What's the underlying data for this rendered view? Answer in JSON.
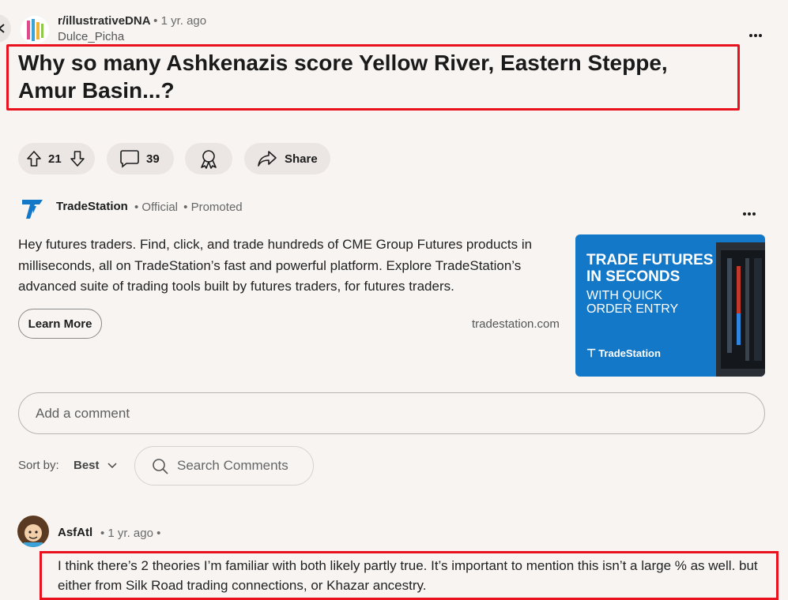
{
  "post": {
    "subreddit": "r/illustrativeDNA",
    "time": "• 1 yr. ago",
    "author": "Dulce_Picha",
    "title": "Why so many Ashkenazis score Yellow River, Eastern Steppe, Amur Basin...?",
    "upvotes": "21",
    "comments_count": "39",
    "share_label": "Share"
  },
  "ad": {
    "advertiser": "TradeStation",
    "official": "• Official",
    "promoted": "• Promoted",
    "text": "Hey futures traders. Find, click, and trade hundreds of CME Group Futures products in milliseconds, all on TradeStation’s fast and powerful platform. Explore TradeStation’s advanced suite of trading tools built by futures traders, for futures traders.",
    "cta": "Learn More",
    "domain": "tradestation.com",
    "banner_line1": "TRADE FUTURES IN SECONDS",
    "banner_line2": "WITH QUICK ORDER ENTRY",
    "banner_brand": "TradeStation"
  },
  "comments_section": {
    "add_comment_placeholder": "Add a comment",
    "sort_label": "Sort by:",
    "sort_value": "Best",
    "search_placeholder": "Search Comments"
  },
  "comment": {
    "author": "AsfAtl",
    "meta": "• 1 yr. ago •",
    "text": "I think there’s 2 theories I’m familiar with both likely partly true. It’s important to mention this isn’t a large % as well. but either from Silk Road trading connections, or Khazar ancestry."
  },
  "colors": {
    "background": "#f7f4f2",
    "pill_bg": "#ebe6e3",
    "highlight_red": "#e8111d",
    "ad_blue": "#1478c8"
  },
  "icons": [
    "back-arrow-icon",
    "more-options-icon",
    "upvote-icon",
    "downvote-icon",
    "comment-icon",
    "award-icon",
    "share-icon",
    "chevron-down-icon",
    "search-icon"
  ]
}
